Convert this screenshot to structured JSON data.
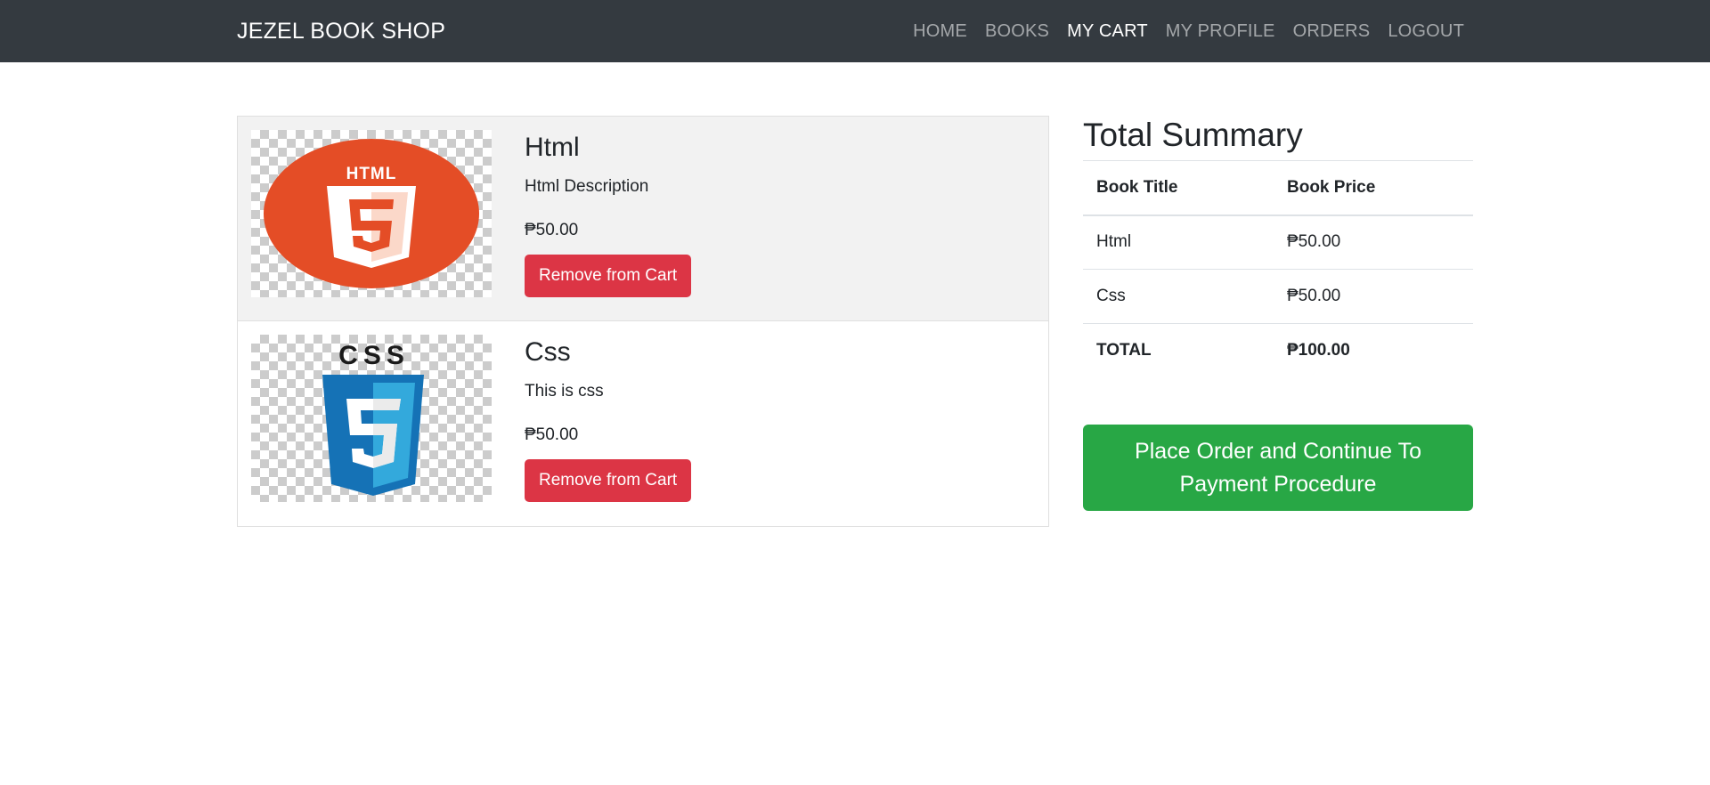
{
  "navbar": {
    "brand": "JEZEL BOOK SHOP",
    "links": [
      {
        "label": "HOME",
        "active": false
      },
      {
        "label": "BOOKS",
        "active": false
      },
      {
        "label": "MY CART",
        "active": true
      },
      {
        "label": "MY PROFILE",
        "active": false
      },
      {
        "label": "ORDERS",
        "active": false
      },
      {
        "label": "LOGOUT",
        "active": false
      }
    ]
  },
  "cart": {
    "items": [
      {
        "title": "Html",
        "description": "Html Description",
        "price": "₱50.00",
        "button": "Remove from Cart",
        "image": "html5-logo",
        "logo_text": "HTML"
      },
      {
        "title": "Css",
        "description": "This is css",
        "price": "₱50.00",
        "button": "Remove from Cart",
        "image": "css3-logo",
        "logo_text": "CSS"
      }
    ]
  },
  "summary": {
    "title": "Total Summary",
    "headers": [
      "Book Title",
      "Book Price"
    ],
    "rows": [
      [
        "Html",
        "₱50.00"
      ],
      [
        "Css",
        "₱50.00"
      ]
    ],
    "total": [
      "TOTAL",
      "₱100.00"
    ],
    "place_order": "Place Order and Continue To Payment Procedure"
  },
  "colors": {
    "navbar": "#343a40",
    "danger": "#dc3545",
    "success": "#28a745",
    "html5": "#e44d26",
    "css3": "#1572b6"
  }
}
